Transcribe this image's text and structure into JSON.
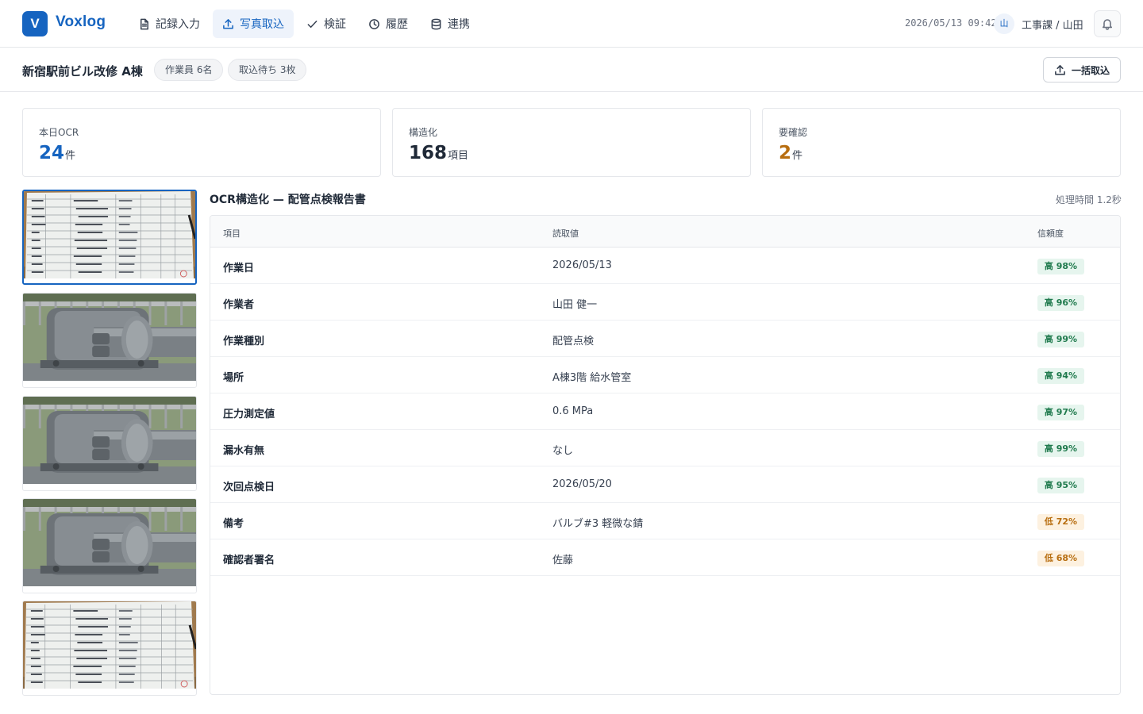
{
  "app": {
    "logo_letter": "V",
    "name": "Voxlog"
  },
  "nav": {
    "items": [
      {
        "label": "記録入力",
        "icon": "document-icon",
        "active": false
      },
      {
        "label": "写真取込",
        "icon": "upload-icon",
        "active": true
      },
      {
        "label": "検証",
        "icon": "check-icon",
        "active": false
      },
      {
        "label": "履歴",
        "icon": "clock-icon",
        "active": false
      },
      {
        "label": "連携",
        "icon": "database-icon",
        "active": false
      }
    ]
  },
  "header": {
    "datetime": "2026/05/13 09:42",
    "avatar_initial": "山",
    "user": "工事課 / 山田"
  },
  "project": {
    "title": "新宿駅前ビル改修 A棟",
    "chips": [
      "作業員 6名",
      "取込待ち 3枚"
    ],
    "bulk_import_label": "一括取込"
  },
  "stats": [
    {
      "label": "本日OCR",
      "value": "24",
      "unit": "件",
      "color": "#1664c0"
    },
    {
      "label": "構造化",
      "value": "168",
      "unit": "項目",
      "color": "#1f2937"
    },
    {
      "label": "要確認",
      "value": "2",
      "unit": "件",
      "color": "#b86e10"
    }
  ],
  "thumbnails": [
    {
      "kind": "document",
      "selected": true
    },
    {
      "kind": "pipe",
      "selected": false
    },
    {
      "kind": "pipe",
      "selected": false
    },
    {
      "kind": "pipe",
      "selected": false
    },
    {
      "kind": "document",
      "selected": false
    }
  ],
  "result": {
    "title": "OCR構造化 — 配管点検報告書",
    "processing_time": "処理時間 1.2秒",
    "columns": {
      "item": "項目",
      "value": "読取値",
      "confidence": "信頼度"
    },
    "rows": [
      {
        "item": "作業日",
        "value": "2026/05/13",
        "confidence": "高 98%",
        "level": "hi"
      },
      {
        "item": "作業者",
        "value": "山田 健一",
        "confidence": "高 96%",
        "level": "hi"
      },
      {
        "item": "作業種別",
        "value": "配管点検",
        "confidence": "高 99%",
        "level": "hi"
      },
      {
        "item": "場所",
        "value": "A棟3階 給水管室",
        "confidence": "高 94%",
        "level": "hi"
      },
      {
        "item": "圧力測定値",
        "value": "0.6 MPa",
        "confidence": "高 97%",
        "level": "hi"
      },
      {
        "item": "漏水有無",
        "value": "なし",
        "confidence": "高 99%",
        "level": "hi"
      },
      {
        "item": "次回点検日",
        "value": "2026/05/20",
        "confidence": "高 95%",
        "level": "hi"
      },
      {
        "item": "備考",
        "value": "バルブ#3 軽微な錆",
        "confidence": "低 72%",
        "level": "lo"
      },
      {
        "item": "確認者署名",
        "value": "佐藤",
        "confidence": "低 68%",
        "level": "lo"
      }
    ]
  }
}
